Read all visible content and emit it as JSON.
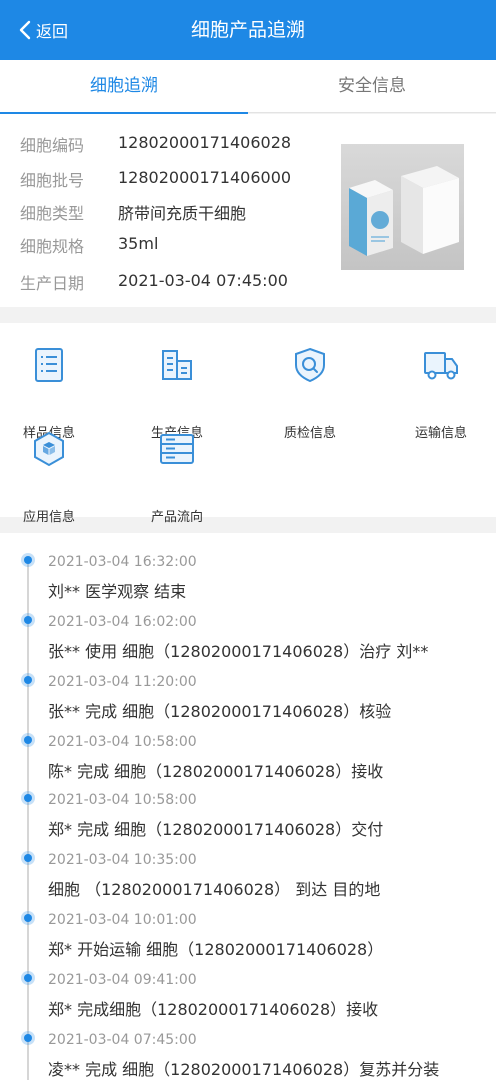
{
  "header": {
    "back_label": "返回",
    "title": "细胞产品追溯"
  },
  "tabs": [
    {
      "label": "细胞追溯",
      "active": true
    },
    {
      "label": "安全信息",
      "active": false
    }
  ],
  "info": {
    "rows": [
      {
        "label": "细胞编码",
        "value": "12802000171406028"
      },
      {
        "label": "细胞批号",
        "value": "12802000171406000"
      },
      {
        "label": "细胞类型",
        "value": "脐带间充质干细胞"
      },
      {
        "label": "细胞规格",
        "value": "35ml"
      },
      {
        "label": "生产日期",
        "value": "2021-03-04 07:45:00"
      }
    ]
  },
  "grid": {
    "items": [
      {
        "label": "样品信息",
        "icon": "list-document-icon"
      },
      {
        "label": "生产信息",
        "icon": "buildings-icon"
      },
      {
        "label": "质检信息",
        "icon": "shield-search-icon"
      },
      {
        "label": "运输信息",
        "icon": "truck-icon"
      },
      {
        "label": "应用信息",
        "icon": "hexagon-cube-icon"
      },
      {
        "label": "产品流向",
        "icon": "layers-list-icon"
      }
    ]
  },
  "timeline": {
    "entries": [
      {
        "time": "2021-03-04 16:32:00",
        "text": "刘** 医学观察 结束"
      },
      {
        "time": "2021-03-04 16:02:00",
        "text": "张** 使用 细胞（12802000171406028）治疗 刘**"
      },
      {
        "time": "2021-03-04 11:20:00",
        "text": "张** 完成 细胞（12802000171406028）核验"
      },
      {
        "time": "2021-03-04 10:58:00",
        "text": "陈* 完成 细胞（12802000171406028）接收"
      },
      {
        "time": "2021-03-04 10:58:00",
        "text": "郑* 完成 细胞（12802000171406028）交付"
      },
      {
        "time": "2021-03-04 10:35:00",
        "text": "细胞 （12802000171406028） 到达 目的地"
      },
      {
        "time": "2021-03-04 10:01:00",
        "text": "郑* 开始运输 细胞（12802000171406028）"
      },
      {
        "time": "2021-03-04 09:41:00",
        "text": "郑* 完成细胞（12802000171406028）接收"
      },
      {
        "time": "2021-03-04 07:45:00",
        "text": "凌** 完成 细胞（12802000171406028）复苏并分装"
      }
    ]
  },
  "colors": {
    "primary": "#1e88e5",
    "label": "#999999",
    "text": "#333333",
    "background": "#f2f2f2"
  }
}
